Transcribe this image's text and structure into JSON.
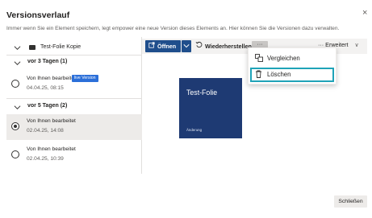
{
  "dialog": {
    "title": "Versionsverlauf",
    "description": "Immer wenn Sie ein Element speichern, legt empower eine neue Version dieses Elements an. Hier können Sie die Versionen dazu verwalten.",
    "close_icon": "×"
  },
  "sidebar": {
    "file_label": "Test-Folie Kopie",
    "groups": [
      {
        "label": "vor 3 Tagen (1)",
        "versions": [
          {
            "by": "Von Ihnen bearbeitet",
            "date": "04.04.25, 08:15",
            "badge": "live Version",
            "selected": false
          }
        ]
      },
      {
        "label": "vor 5 Tagen (2)",
        "versions": [
          {
            "by": "Von Ihnen bearbeitet",
            "date": "02.04.25, 14:08",
            "selected": true
          },
          {
            "by": "Von Ihnen bearbeitet",
            "date": "02.04.25, 10:39",
            "selected": false
          }
        ]
      }
    ]
  },
  "toolbar": {
    "open_label": "Öffnen",
    "restore_label": "Wiederherstellen",
    "more_label": "···",
    "advanced_label": "··· Erweitert",
    "advanced_chevron": "∨"
  },
  "menu": {
    "compare_label": "Vergleichen",
    "delete_label": "Löschen"
  },
  "preview": {
    "title": "Test-Folie",
    "subtitle": "Änderung"
  },
  "footer": {
    "close_label": "Schließen"
  },
  "colors": {
    "primary": "#1f4e8c",
    "live_badge": "#2b6fd9",
    "preview_bg": "#1e3a73",
    "focus_outline": "#1fa3b8"
  }
}
